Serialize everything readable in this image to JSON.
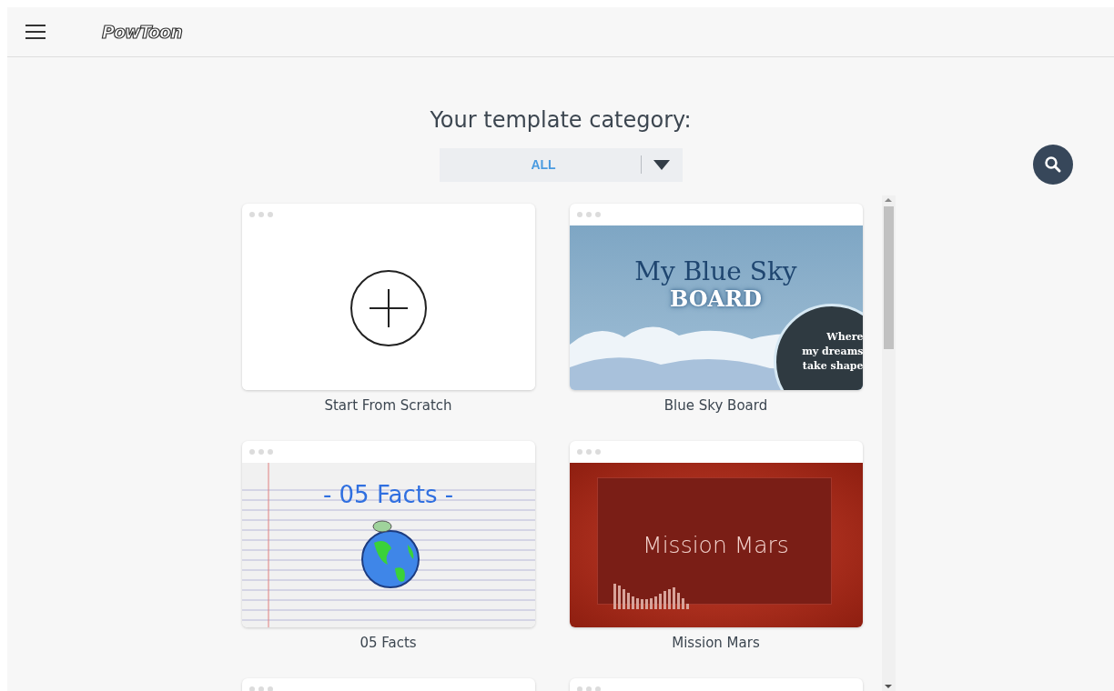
{
  "header": {
    "logo": "PowToon"
  },
  "title": "Your template category:",
  "category_dropdown": {
    "value": "ALL"
  },
  "templates": [
    {
      "label": "Start From Scratch",
      "thumbnail": {
        "kind": "scratch"
      }
    },
    {
      "label": "Blue Sky Board",
      "thumbnail": {
        "kind": "sky",
        "lines": [
          "My Blue Sky",
          "BOARD",
          "Where",
          "my dreams",
          "take shape"
        ]
      }
    },
    {
      "label": "05 Facts",
      "thumbnail": {
        "kind": "paper",
        "lines": [
          "- 05 Facts -"
        ]
      }
    },
    {
      "label": "Mission Mars",
      "thumbnail": {
        "kind": "mars",
        "lines": [
          "Mission Mars"
        ]
      }
    },
    {
      "thumbnail": {
        "kind": "hidden"
      }
    },
    {
      "thumbnail": {
        "kind": "hidden"
      }
    }
  ]
}
